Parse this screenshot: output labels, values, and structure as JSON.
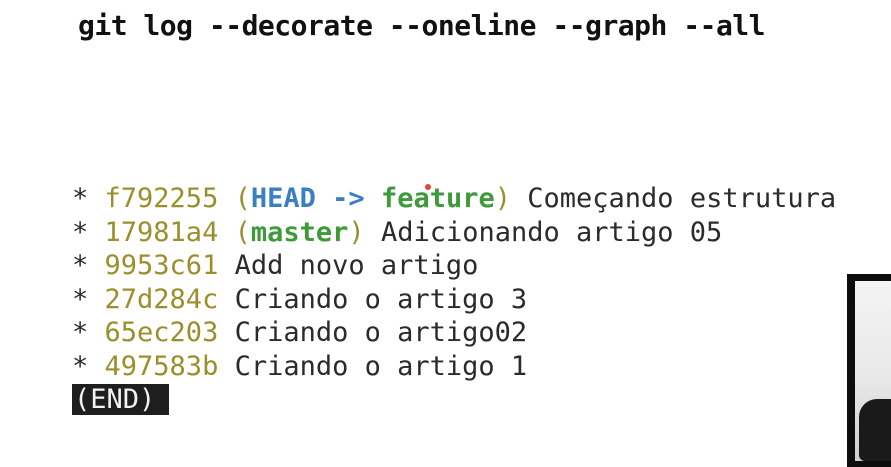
{
  "terminal": {
    "command": "git log --decorate --oneline --graph --all",
    "end_marker": "(END)"
  },
  "commits": [
    {
      "graph": "*",
      "hash": "f792255",
      "refs_open": "(",
      "head": "HEAD",
      "arrow": "->",
      "branch": "feature",
      "refs_close": ")",
      "message": "Começando estrutura"
    },
    {
      "graph": "*",
      "hash": "17981a4",
      "refs_open": "(",
      "branch": "master",
      "refs_close": ")",
      "message": "Adicionando artigo 05"
    },
    {
      "graph": "*",
      "hash": "9953c61",
      "message": "Add novo artigo"
    },
    {
      "graph": "*",
      "hash": "27d284c",
      "message": "Criando o artigo 3"
    },
    {
      "graph": "*",
      "hash": "65ec203",
      "message": "Criando o artigo02"
    },
    {
      "graph": "*",
      "hash": "497583b",
      "message": "Criando o artigo 1"
    }
  ],
  "colors": {
    "hash": "#9a8f2a",
    "head": "#3a7fc1",
    "branch": "#3f9a3a",
    "text": "#2b2b2b",
    "end_bg": "#1e1e1e"
  }
}
